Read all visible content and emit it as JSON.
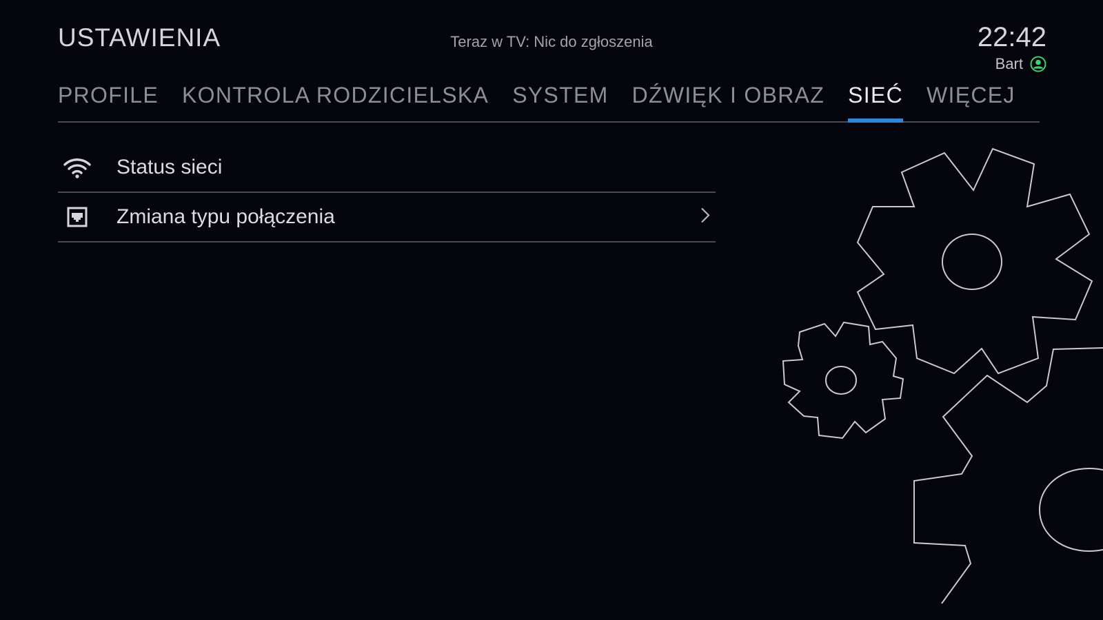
{
  "header": {
    "title": "USTAWIENIA",
    "now_on_tv": "Teraz w TV: Nic do zgłoszenia",
    "clock": "22:42",
    "user_name": "Bart"
  },
  "tabs": [
    {
      "label": "PROFILE",
      "active": false
    },
    {
      "label": "KONTROLA RODZICIELSKA",
      "active": false
    },
    {
      "label": "SYSTEM",
      "active": false
    },
    {
      "label": "DŹWIĘK I OBRAZ",
      "active": false
    },
    {
      "label": "SIEĆ",
      "active": true
    },
    {
      "label": "WIĘCEJ",
      "active": false
    }
  ],
  "menu": {
    "items": [
      {
        "label": "Status sieci",
        "icon": "wifi-icon"
      },
      {
        "label": "Zmiana typu połączenia",
        "icon": "ethernet-port-icon",
        "has_submenu": true
      }
    ]
  },
  "colors": {
    "background": "#05050d",
    "accent_blue": "#2d86d6",
    "user_status_green": "#3fd16a"
  }
}
